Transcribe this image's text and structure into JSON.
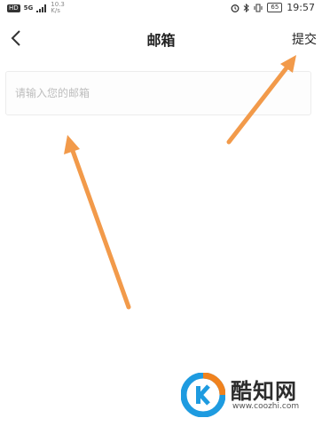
{
  "status_bar": {
    "hd": "HD",
    "network": "5G",
    "speed_value": "10.3",
    "speed_unit": "K/s",
    "battery": "65",
    "time": "19:57"
  },
  "header": {
    "title": "邮箱",
    "submit_label": "提交"
  },
  "form": {
    "email_placeholder": "请输入您的邮箱",
    "email_value": ""
  },
  "watermark": {
    "name": "酷知网",
    "url": "www.coozhi.com"
  },
  "colors": {
    "arrow": "#F29A4A",
    "logo_blue": "#1E9BE0",
    "logo_orange": "#F0821E"
  }
}
